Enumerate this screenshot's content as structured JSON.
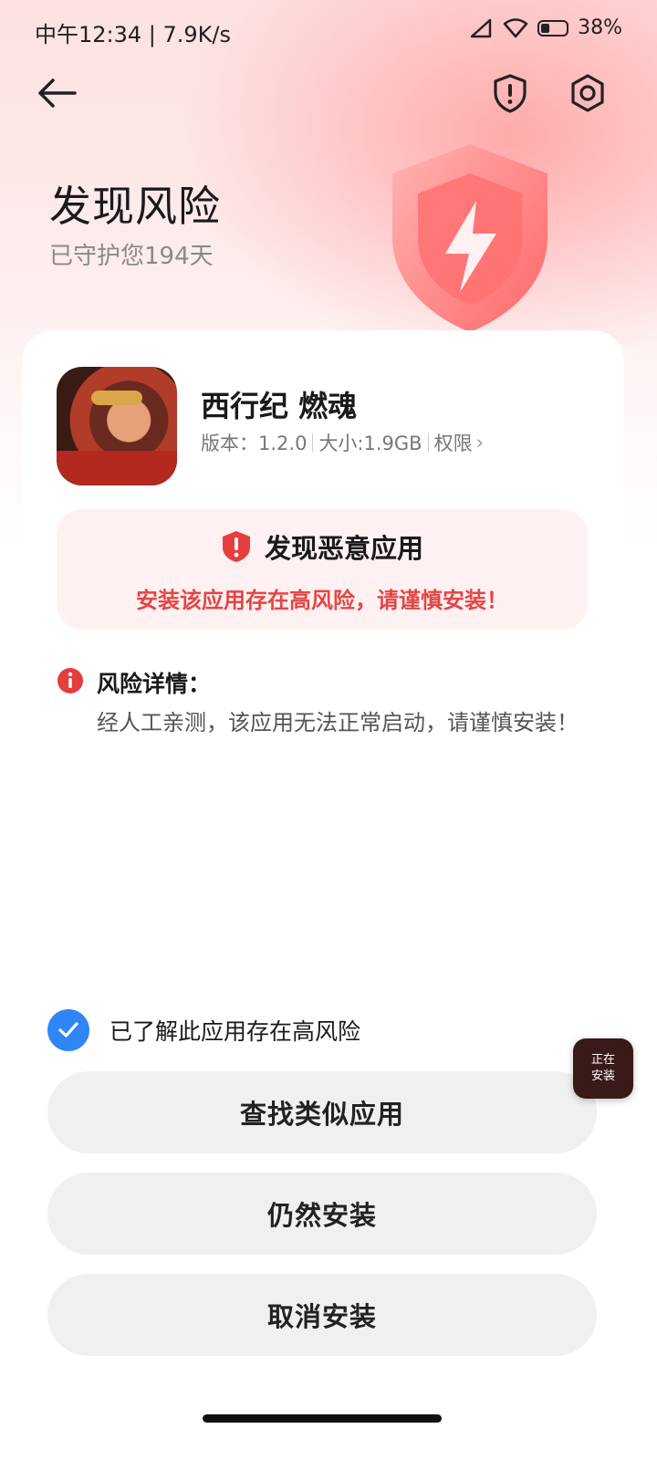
{
  "status_bar": {
    "time": "中午12:34 | 7.9K/s",
    "battery": "38%"
  },
  "header": {
    "title": "发现风险",
    "subtitle": "已守护您194天"
  },
  "app": {
    "name": "西行纪 燃魂",
    "version": "版本：1.2.0",
    "size": "大小:1.9GB",
    "permissions": "权限"
  },
  "alert": {
    "title": "发现恶意应用",
    "description": "安装该应用存在高风险，请谨慎安装！"
  },
  "risk": {
    "label": "风险详情：",
    "text": "经人工亲测，该应用无法正常启动，请谨慎安装！"
  },
  "acknowledge": {
    "checked": true,
    "label": "已了解此应用存在高风险"
  },
  "buttons": {
    "find_similar": "查找类似应用",
    "install_anyway": "仍然安装",
    "cancel": "取消安装"
  },
  "float_badge": {
    "line1": "正在",
    "line2": "安装"
  },
  "colors": {
    "accent_blue": "#2f86f6",
    "danger_red": "#e54545",
    "alert_bg": "#fff1f1"
  }
}
